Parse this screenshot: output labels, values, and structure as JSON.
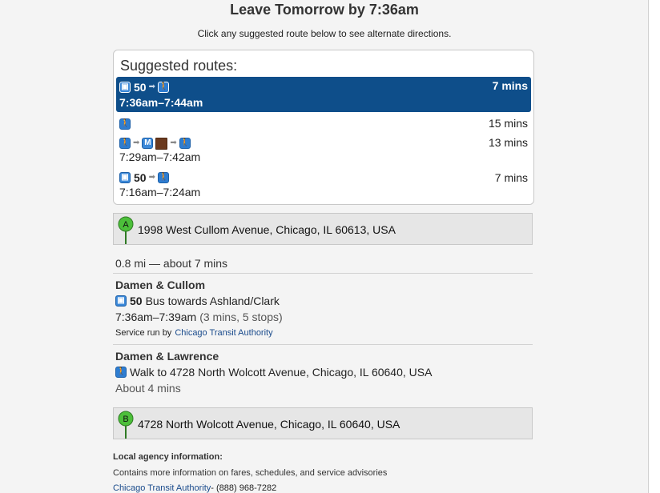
{
  "header": {
    "title": "Leave Tomorrow by 7:36am",
    "subtitle": "Click any suggested route below to see alternate directions."
  },
  "routes": {
    "title": "Suggested routes:",
    "items": [
      {
        "bus": "50",
        "time": "7:36am–7:44am",
        "duration": "7 mins",
        "selected": true
      },
      {
        "time": "",
        "duration": "15 mins"
      },
      {
        "metro": "M",
        "time": "7:29am–7:42am",
        "duration": "13 mins"
      },
      {
        "bus": "50",
        "time": "7:16am–7:24am",
        "duration": "7 mins"
      }
    ]
  },
  "origin": {
    "marker": "A",
    "address": "1998 West Cullom Avenue, Chicago, IL 60613, USA"
  },
  "summary": "0.8 mi — about 7 mins",
  "step1": {
    "stop": "Damen & Cullom",
    "bus_number": "50",
    "bus_text": "Bus towards Ashland/Clark",
    "time": "7:36am–7:39am",
    "detail": "(3 mins, 5 stops)",
    "service_prefix": "Service run by",
    "agency": "Chicago Transit Authority"
  },
  "step2": {
    "stop": "Damen & Lawrence",
    "walk_text": "Walk to 4728 North Wolcott Avenue, Chicago, IL 60640, USA",
    "duration": "About 4 mins"
  },
  "destination": {
    "marker": "B",
    "address": "4728 North Wolcott Avenue, Chicago, IL 60640, USA"
  },
  "agency_info": {
    "heading": "Local agency information:",
    "description": "Contains more information on fares, schedules, and service advisories",
    "link": "Chicago Transit Authority",
    "phone": " - (888) 968-7282"
  },
  "colors": {
    "selected": "#0e4e8a",
    "pin": "#4cbf3a",
    "link": "#1a4b8c"
  }
}
